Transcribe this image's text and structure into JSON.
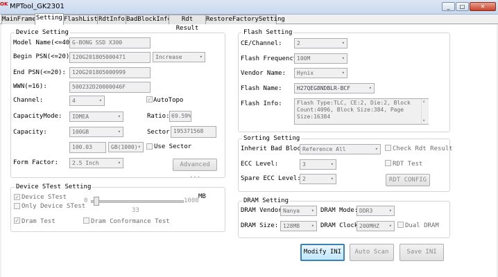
{
  "window": {
    "icon_text": "OK",
    "title": "MPTool_GK2301",
    "controls": {
      "minimize": "_",
      "maximize": "□",
      "close": "✕"
    }
  },
  "tabs": [
    "MainFrame",
    "Setting",
    "FlashList",
    "RdtInfo",
    "BadBlockInfo",
    "Rdt Result",
    "RestoreFactorySetting"
  ],
  "device_setting": {
    "title": "Device Setting",
    "model_name_label": "Model Name(<=40):",
    "model_name": "G-BONG SSD X300",
    "begin_psn_label": "Begin PSN(<=20):",
    "begin_psn": "120G201805000471",
    "increase": "Increase",
    "end_psn_label": "End PSN(<=20):",
    "end_psn": "120G201805000999",
    "wwn_label": "WWN(=16):",
    "wwn": "500232D20000046F",
    "channel_label": "Channel:",
    "channel": "4",
    "autotopo_label": "AutoTopo",
    "capacity_mode_label": "CapacityMode:",
    "capacity_mode": "IDMEA",
    "ratio_label": "Ratio:",
    "ratio": "69.59%",
    "capacity_label": "Capacity:",
    "capacity": "100GB",
    "sector_label": "Sector:",
    "sector": "195371568",
    "capacity_num": "100.03",
    "capacity_unit": "GB(1000)",
    "use_sector_label": "Use Sector",
    "form_factor_label": "Form Factor:",
    "form_factor": "2.5 Inch",
    "advanced_button": "Advanced ..."
  },
  "device_stest": {
    "title": "Device STest Setting",
    "device_stest_label": "Device STest",
    "only_device_stest_label": "Only Device STest",
    "dram_test_label": "Dram Test",
    "dram_conformance_label": "Dram Conformance Test",
    "slider_min": "0",
    "slider_max": "1000",
    "slider_unit": "MB",
    "slider_value": "33",
    "slider_fraction": 0.033
  },
  "flash_setting": {
    "title": "Flash Setting",
    "ce_label": "CE/Channel:",
    "ce": "2",
    "freq_label": "Flash Frequency:",
    "freq": "100M",
    "vendor_label": "Vendor Name:",
    "vendor": "Hynix",
    "flash_name_label": "Flash Name:",
    "flash_name": "H27QEG8NDBLR-BCF",
    "flash_info_label": "Flash Info:",
    "flash_info": "Flash Type:TLC, CE:2, Die:2, Block Count:4096, Block Size:384, Page Size:16384"
  },
  "sorting_setting": {
    "title": "Sorting Setting",
    "inherit_label": "Inherit Bad Block:",
    "inherit": "Reference All",
    "check_rdt_label": "Check Rdt Result",
    "ecc_label": "ECC Level:",
    "ecc": "3",
    "rdt_test_label": "RDT Test",
    "spare_ecc_label": "Spare ECC Level:",
    "spare_ecc": "2",
    "rdt_config_button": "RDT CONFIG"
  },
  "dram_setting": {
    "title": "DRAM Setting",
    "vendor_label": "DRAM Vendor:",
    "vendor": "Nanya",
    "mode_label": "DRAM Mode:",
    "mode": "DDR3",
    "size_label": "DRAM Size:",
    "size": "128MB",
    "clock_label": "DRAM Clock:",
    "clock": "200MHZ",
    "dual_dram_label": "Dual DRAM"
  },
  "buttons": {
    "modify_ini": "Modify INI",
    "auto_scan": "Auto Scan",
    "save_ini": "Save INI"
  },
  "icons": {
    "dropdown": "▾",
    "check": "✓",
    "scroll_up": "▴",
    "scroll_down": "▾"
  }
}
